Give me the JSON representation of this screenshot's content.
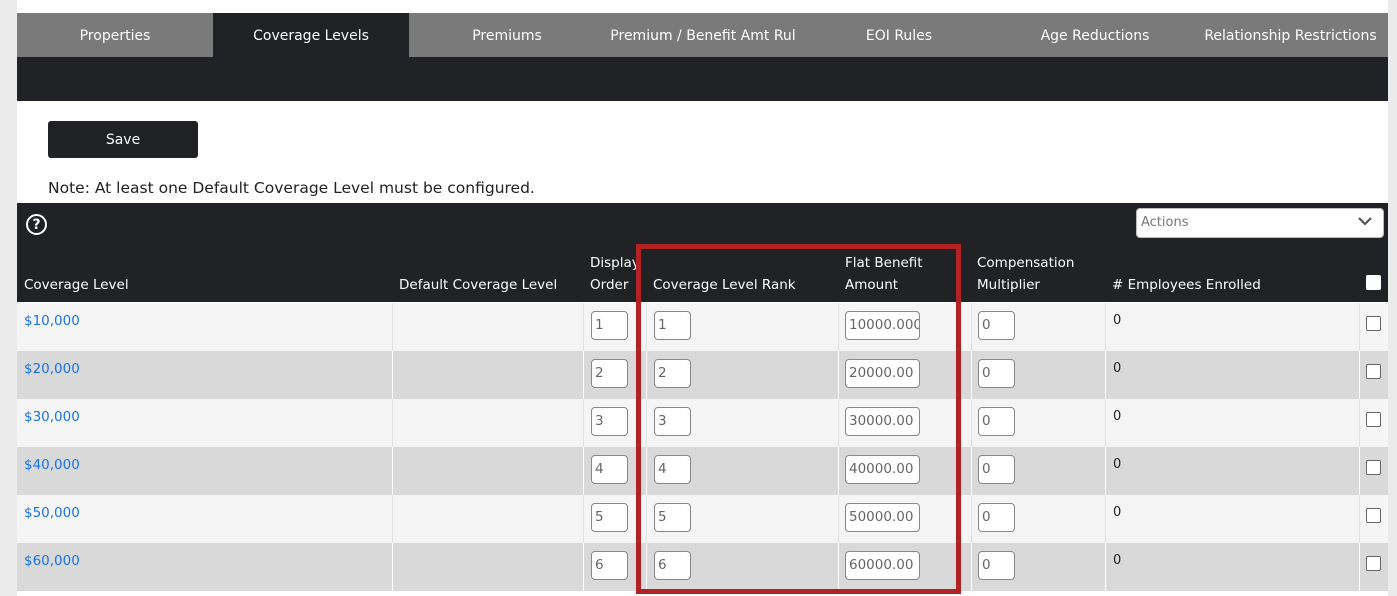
{
  "tabs": [
    {
      "label": "Properties",
      "active": false
    },
    {
      "label": "Coverage Levels",
      "active": true
    },
    {
      "label": "Premiums",
      "active": false
    },
    {
      "label": "Premium / Benefit Amt Rul",
      "active": false
    },
    {
      "label": "EOI Rules",
      "active": false
    },
    {
      "label": "Age Reductions",
      "active": false
    },
    {
      "label": "Relationship Restrictions",
      "active": false
    }
  ],
  "save_label": "Save",
  "note": "Note: At least one Default Coverage Level must be configured.",
  "actions": {
    "placeholder": "Actions",
    "icon": "chevron-down-icon"
  },
  "help_icon": "help-icon",
  "columns": {
    "coverage_level": "Coverage Level",
    "default_coverage_level": "Default Coverage Level",
    "display_order_1": "Display",
    "display_order_2": "Order",
    "rank": "Coverage Level Rank",
    "flat_benefit_1": "Flat Benefit",
    "flat_benefit_2": "Amount",
    "comp_mult_1": "Compensation",
    "comp_mult_2": "Multiplier",
    "employees": "# Employees Enrolled"
  },
  "rows": [
    {
      "level": "$10,000",
      "display_order": "1",
      "rank": "1",
      "flat_benefit": "10000.000",
      "multiplier": "0",
      "enrolled": "0"
    },
    {
      "level": "$20,000",
      "display_order": "2",
      "rank": "2",
      "flat_benefit": "20000.00",
      "multiplier": "0",
      "enrolled": "0"
    },
    {
      "level": "$30,000",
      "display_order": "3",
      "rank": "3",
      "flat_benefit": "30000.00",
      "multiplier": "0",
      "enrolled": "0"
    },
    {
      "level": "$40,000",
      "display_order": "4",
      "rank": "4",
      "flat_benefit": "40000.00",
      "multiplier": "0",
      "enrolled": "0"
    },
    {
      "level": "$50,000",
      "display_order": "5",
      "rank": "5",
      "flat_benefit": "50000.00",
      "multiplier": "0",
      "enrolled": "0"
    },
    {
      "level": "$60,000",
      "display_order": "6",
      "rank": "6",
      "flat_benefit": "60000.00",
      "multiplier": "0",
      "enrolled": "0"
    }
  ],
  "colors": {
    "dark": "#202226",
    "tab_bar": "#7a7a7a",
    "link": "#1a73e8",
    "highlight": "#b22222"
  }
}
